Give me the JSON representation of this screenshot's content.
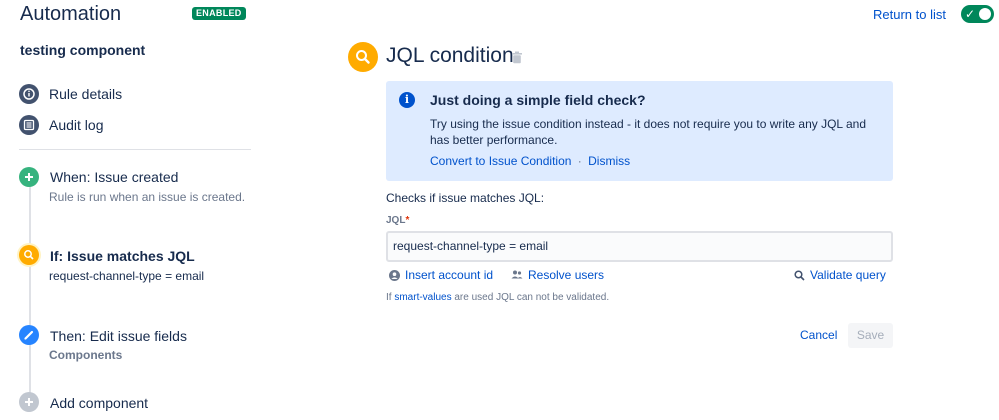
{
  "header": {
    "title": "Automation",
    "status_badge": "ENABLED",
    "return_link": "Return to list",
    "toggle_state": "on"
  },
  "sidebar": {
    "rule_name": "testing component",
    "nav": [
      {
        "label": "Rule details",
        "icon": "info-icon"
      },
      {
        "label": "Audit log",
        "icon": "list-icon"
      }
    ],
    "steps": [
      {
        "title": "When: Issue created",
        "subtitle": "Rule is run when an issue is created.",
        "icon": "plus-icon",
        "color": "#36b37e"
      },
      {
        "title": "If: Issue matches JQL",
        "subtitle": "request-channel-type = email",
        "icon": "search-icon",
        "color": "#ffab00"
      },
      {
        "title": "Then: Edit issue fields",
        "subtitle": "Components",
        "icon": "pencil-icon",
        "color": "#2684ff"
      },
      {
        "title": "Add component",
        "subtitle": "",
        "icon": "plus-icon",
        "color": "#c1c7d0"
      }
    ]
  },
  "main": {
    "title": "JQL condition",
    "info": {
      "title": "Just doing a simple field check?",
      "body": "Try using the issue condition instead - it does not require you to write any JQL and has better performance.",
      "link_convert": "Convert to Issue Condition",
      "separator": "·",
      "link_dismiss": "Dismiss"
    },
    "checks_label": "Checks if issue matches JQL:",
    "jql_label": "JQL",
    "jql_required_mark": "*",
    "jql_value": "request-channel-type = email",
    "actions": {
      "insert_account": "Insert account id",
      "resolve_users": "Resolve users",
      "validate_query": "Validate query"
    },
    "hint_prefix": "If ",
    "hint_link": "smart-values",
    "hint_suffix": " are used JQL can not be validated.",
    "cancel_label": "Cancel",
    "save_label": "Save"
  },
  "colors": {
    "brand_blue": "#0052cc",
    "enabled_green": "#00875a",
    "info_bg": "#deebff",
    "condition_yellow": "#ffab00"
  }
}
